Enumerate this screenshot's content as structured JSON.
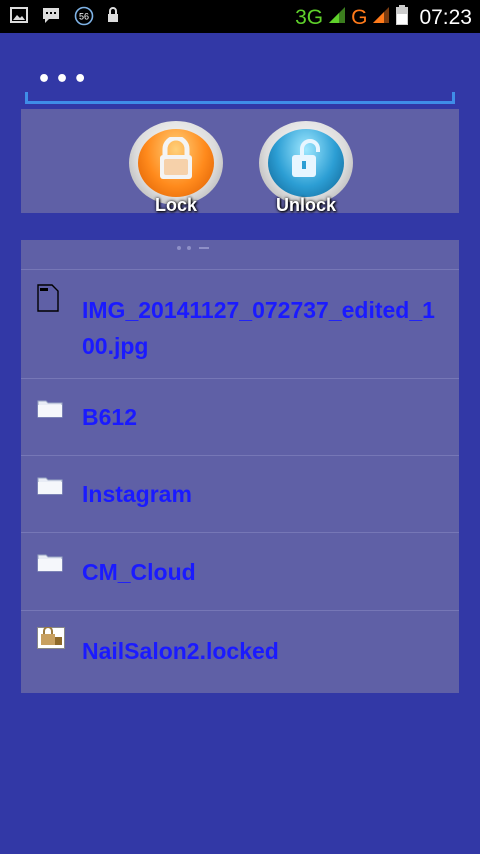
{
  "status_bar": {
    "network1": "3G",
    "network2": "G",
    "time": "07:23",
    "icons": [
      "image-icon",
      "chat-icon",
      "56-badge-icon",
      "lock-icon",
      "signal-icon",
      "battery-icon"
    ]
  },
  "password_field": {
    "value": "•••"
  },
  "buttons": {
    "lock_label": "Lock",
    "unlock_label": "Unlock"
  },
  "files": [
    {
      "name": "IMG_20141127_072737_edited_100.jpg",
      "icon": "file-icon"
    },
    {
      "name": "B612",
      "icon": "folder-icon"
    },
    {
      "name": "Instagram",
      "icon": "folder-icon"
    },
    {
      "name": "CM_Cloud",
      "icon": "folder-icon"
    },
    {
      "name": "NailSalon2.locked",
      "icon": "locked-file-icon"
    }
  ],
  "colors": {
    "background": "#3238a6",
    "panel": "#5f60a6",
    "file_text": "#1a1aff",
    "accent": "#3f8de8"
  }
}
